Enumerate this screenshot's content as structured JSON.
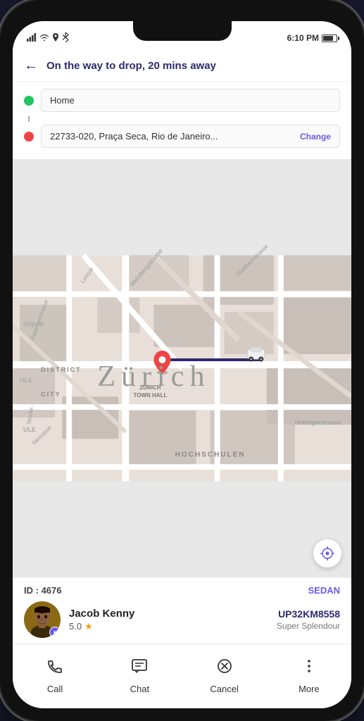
{
  "statusBar": {
    "leftIcons": [
      "signal",
      "wifi",
      "location",
      "bluetooth"
    ],
    "time": "6:10 PM",
    "batteryLevel": 70
  },
  "header": {
    "backLabel": "←",
    "title": "On the way to drop, 20 mins away"
  },
  "route": {
    "origin": "Home",
    "destination": "22733-020, Praça Seca, Rio de Janeiro...",
    "changeLabel": "Change"
  },
  "map": {
    "cityLabel": "Zürich",
    "districtLabel": "DISTRICT",
    "cityAreaLabel": "CITY",
    "townHallLabel": "ZURICH\nTOWN HALL",
    "hochschulenLabel": "HOCHSCHULEN",
    "locationBtnIcon": "⊕"
  },
  "driver": {
    "idLabel": "ID :",
    "idValue": "4676",
    "vehicleType": "SEDAN",
    "name": "Jacob Kenny",
    "rating": "5.0",
    "starIcon": "★",
    "plateNumber": "UP32KM8558",
    "vehicleModel": "Super Splendour"
  },
  "actions": [
    {
      "id": "call",
      "label": "Call",
      "icon": "call"
    },
    {
      "id": "chat",
      "label": "Chat",
      "icon": "chat"
    },
    {
      "id": "cancel",
      "label": "Cancel",
      "icon": "cancel"
    },
    {
      "id": "more",
      "label": "More",
      "icon": "more"
    }
  ]
}
